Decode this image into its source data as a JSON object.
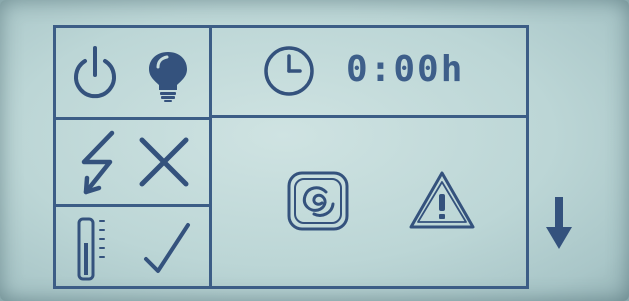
{
  "status": {
    "timer_display": "0:00h"
  },
  "icons": {
    "power": "power-icon",
    "light": "light-bulb-icon",
    "clock": "clock-icon",
    "power_fault": "lightning-icon",
    "cancel": "cross-icon",
    "temperature": "thermometer-icon",
    "ok": "checkmark-icon",
    "swirl": "swirl-program-icon",
    "warning": "warning-triangle-icon",
    "scroll": "down-arrow-icon"
  },
  "colors": {
    "lcd_background": "#c6dcdc",
    "segment": "#34527d"
  }
}
